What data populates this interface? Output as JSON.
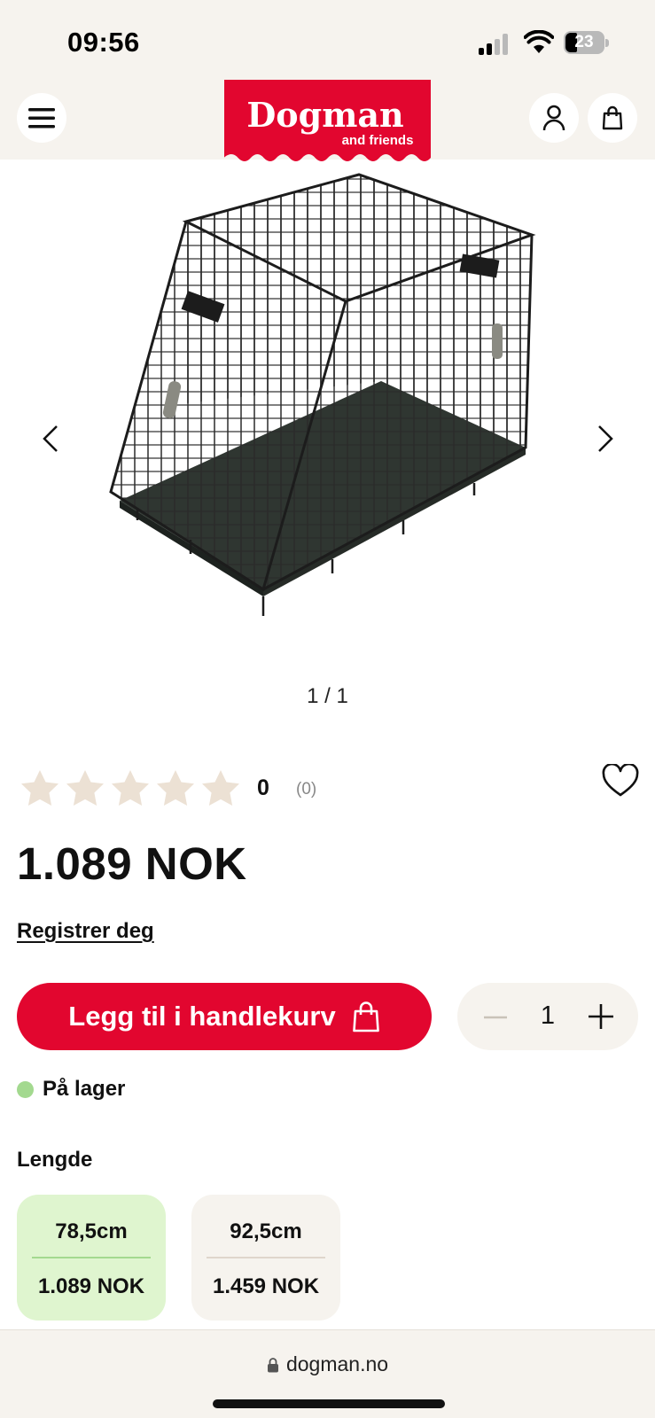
{
  "status_bar": {
    "time": "09:56",
    "battery": "23"
  },
  "header": {
    "logo_main": "Dogman",
    "logo_sub": "and friends",
    "brand_color": "#e2062f"
  },
  "gallery": {
    "counter": "1 / 1"
  },
  "rating": {
    "average": "0",
    "count": "(0)",
    "stars_filled": 0,
    "stars_total": 5
  },
  "product": {
    "price": "1.089 NOK",
    "register_link": "Registrer deg",
    "add_to_cart": "Legg til i handlekurv",
    "quantity": "1",
    "stock_status": "På lager"
  },
  "variants": {
    "label": "Lengde",
    "options": [
      {
        "size": "78,5cm",
        "price": "1.089 NOK",
        "selected": true
      },
      {
        "size": "92,5cm",
        "price": "1.459 NOK",
        "selected": false
      }
    ]
  },
  "browser": {
    "url": "dogman.no"
  }
}
